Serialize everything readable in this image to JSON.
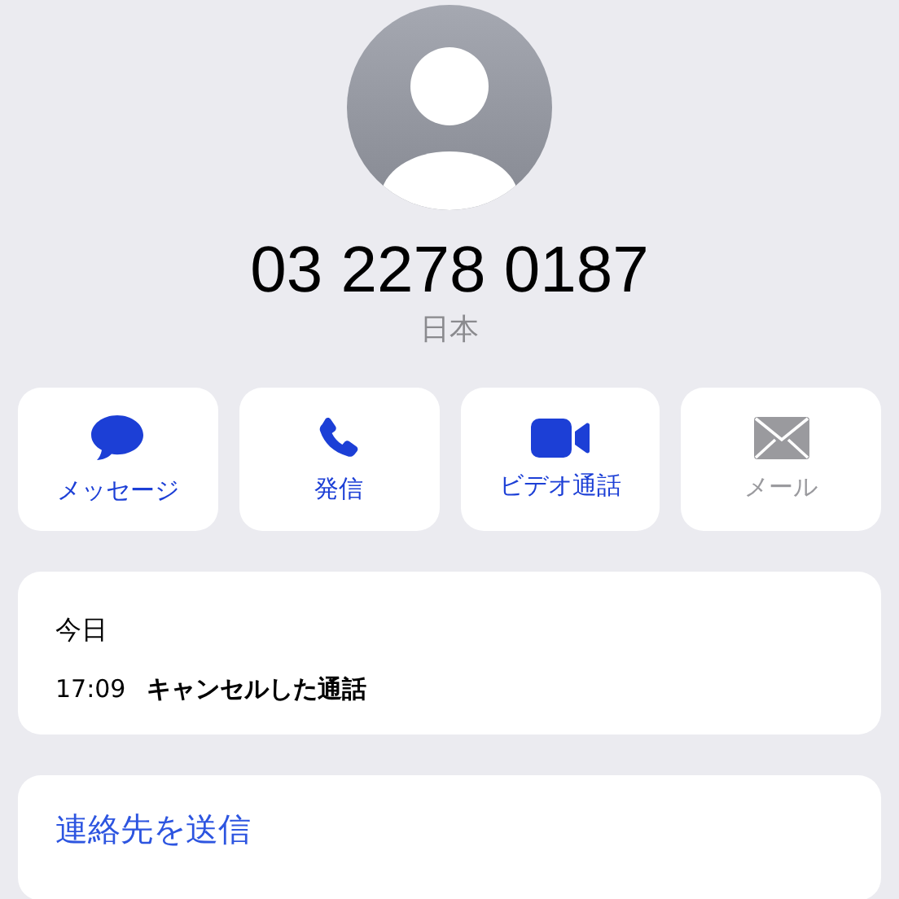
{
  "contact": {
    "phone": "03 2278 0187",
    "region": "日本"
  },
  "actions": [
    {
      "kind": "message",
      "label": "メッセージ",
      "disabled": false
    },
    {
      "kind": "call",
      "label": "発信",
      "disabled": false
    },
    {
      "kind": "video",
      "label": "ビデオ通話",
      "disabled": false
    },
    {
      "kind": "mail",
      "label": "メール",
      "disabled": true
    }
  ],
  "history": {
    "heading": "今日",
    "entries": [
      {
        "time": "17:09",
        "description": "キャンセルした通話"
      }
    ]
  },
  "links": [
    "連絡先を送信"
  ]
}
